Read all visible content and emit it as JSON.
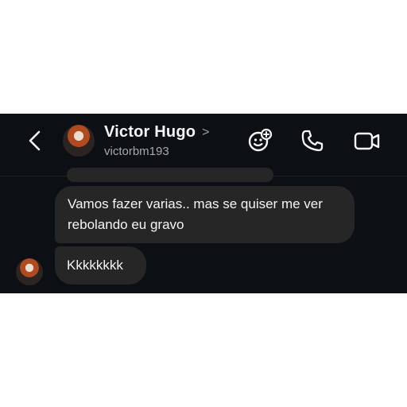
{
  "contact": {
    "name": "Victor Hugo",
    "username": "victorbm193",
    "chevron": ">",
    "avatar_icon": "profile-photo"
  },
  "icons": {
    "back": "chevron-left-icon",
    "effects": "smiley-sparkle-icon",
    "call": "phone-icon",
    "video": "video-camera-icon"
  },
  "messages": [
    {
      "sender": "contact",
      "text": "Vamos fazer varias.. mas se quiser me ver rebolando eu gravo"
    },
    {
      "sender": "contact",
      "text": "Kkkkkkkk"
    }
  ],
  "colors": {
    "background": "#0c1014",
    "bubble": "#262626",
    "text": "#f5f5f5",
    "secondary_text": "#a8a8a8"
  }
}
